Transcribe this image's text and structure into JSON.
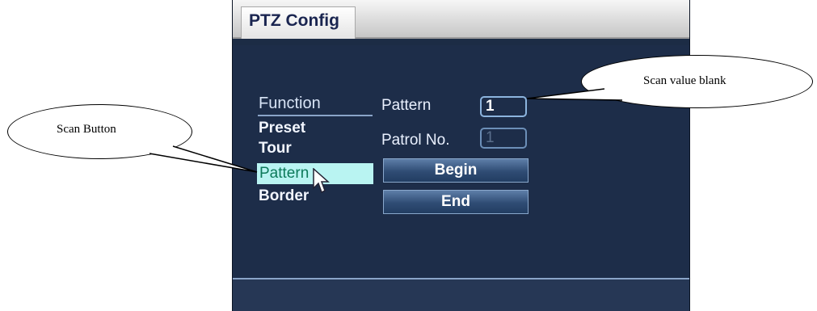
{
  "window": {
    "title": "PTZ Config"
  },
  "function_menu": {
    "header": "Function",
    "items": [
      {
        "label": "Preset",
        "selected": false
      },
      {
        "label": "Tour",
        "selected": false
      },
      {
        "label": "Pattern",
        "selected": true
      },
      {
        "label": "Border",
        "selected": false
      }
    ]
  },
  "fields": {
    "pattern_label": "Pattern",
    "pattern_value": "1",
    "patrol_label": "Patrol No.",
    "patrol_value": "1"
  },
  "buttons": {
    "begin": "Begin",
    "end": "End"
  },
  "callouts": {
    "scan_button": "Scan Button",
    "scan_value": "Scan value blank"
  },
  "colors": {
    "panel_bg": "#1d2d49",
    "highlight": "#b9f4f2",
    "highlight_text": "#0d7a5b"
  },
  "icons": {
    "cursor": "mouse-pointer-icon"
  }
}
